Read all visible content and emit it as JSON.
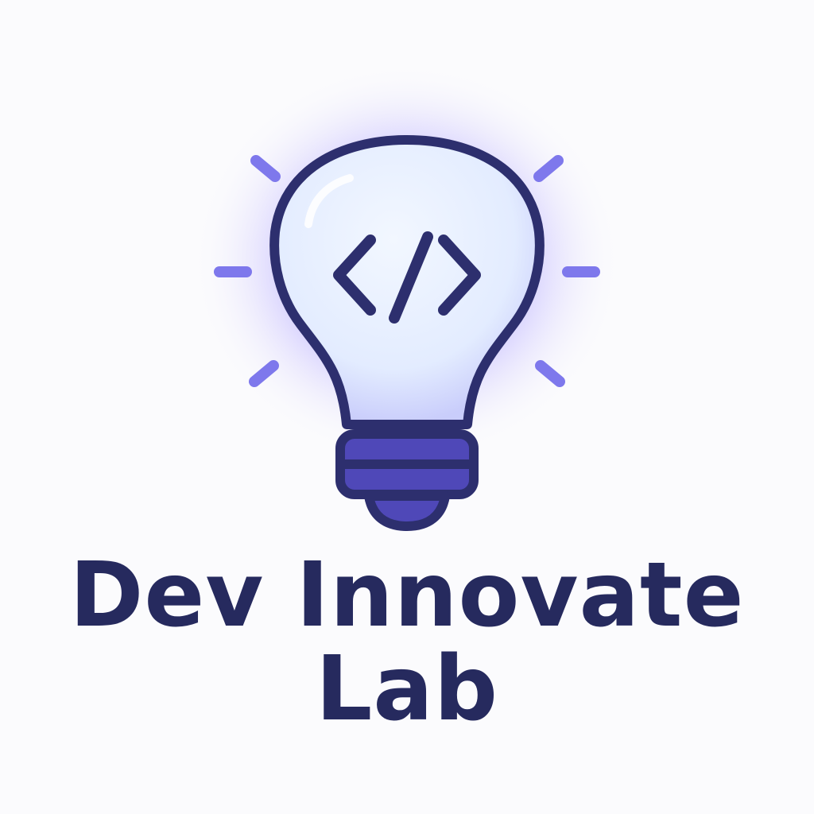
{
  "logo": {
    "icon": "lightbulb-code-icon",
    "glyph_icon": "code-brackets-icon",
    "rays_icon": "light-rays-icon",
    "colors": {
      "outline": "#2d2f6e",
      "bulb_fill": "#e6efff",
      "glow": "#8f7dff",
      "rays": "#7e78ec",
      "base_fill": "#4f48b8",
      "text": "#262a5e",
      "background": "#fbfbfd"
    }
  },
  "brand": {
    "line1": "Dev Innovate",
    "line2": "Lab"
  }
}
